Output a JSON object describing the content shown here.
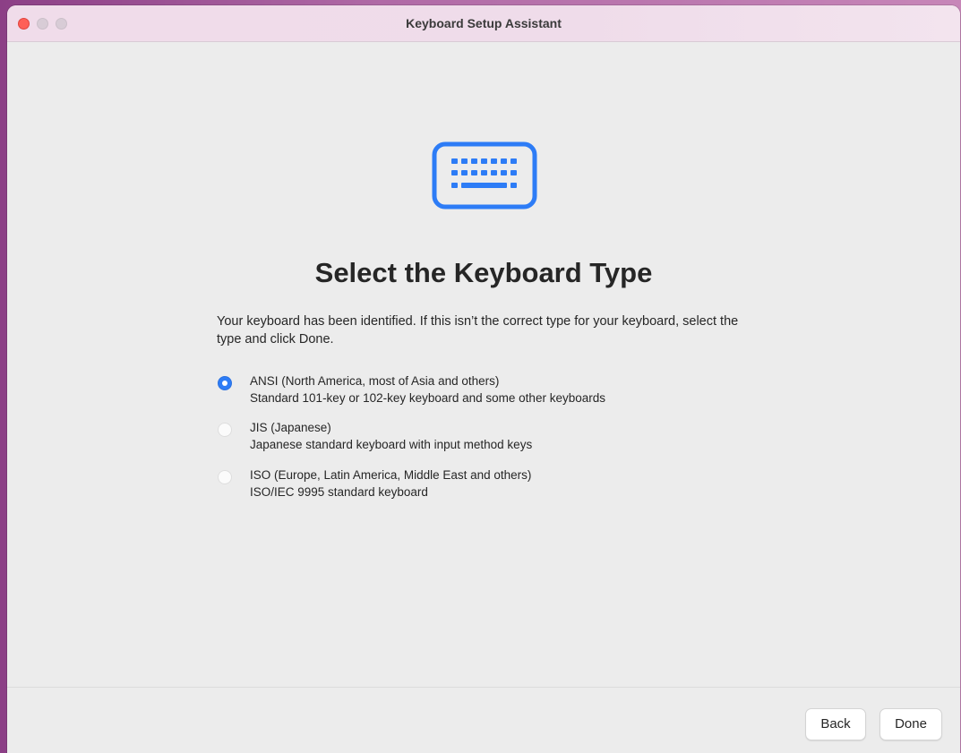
{
  "window": {
    "title": "Keyboard Setup Assistant"
  },
  "main": {
    "icon": "keyboard-icon",
    "heading": "Select the Keyboard Type",
    "description": "Your keyboard has been identified. If this isn’t the correct type for your keyboard, select the type and click Done.",
    "options": [
      {
        "title": "ANSI (North America, most of Asia and others)",
        "subtitle": "Standard 101-key or 102-key keyboard and some other keyboards",
        "selected": true
      },
      {
        "title": "JIS (Japanese)",
        "subtitle": "Japanese standard keyboard with input method keys",
        "selected": false
      },
      {
        "title": "ISO (Europe, Latin America, Middle East and others)",
        "subtitle": "ISO/IEC 9995 standard keyboard",
        "selected": false
      }
    ]
  },
  "footer": {
    "back_label": "Back",
    "done_label": "Done"
  },
  "colors": {
    "accent": "#2d7cf6",
    "close": "#fe5f57"
  }
}
